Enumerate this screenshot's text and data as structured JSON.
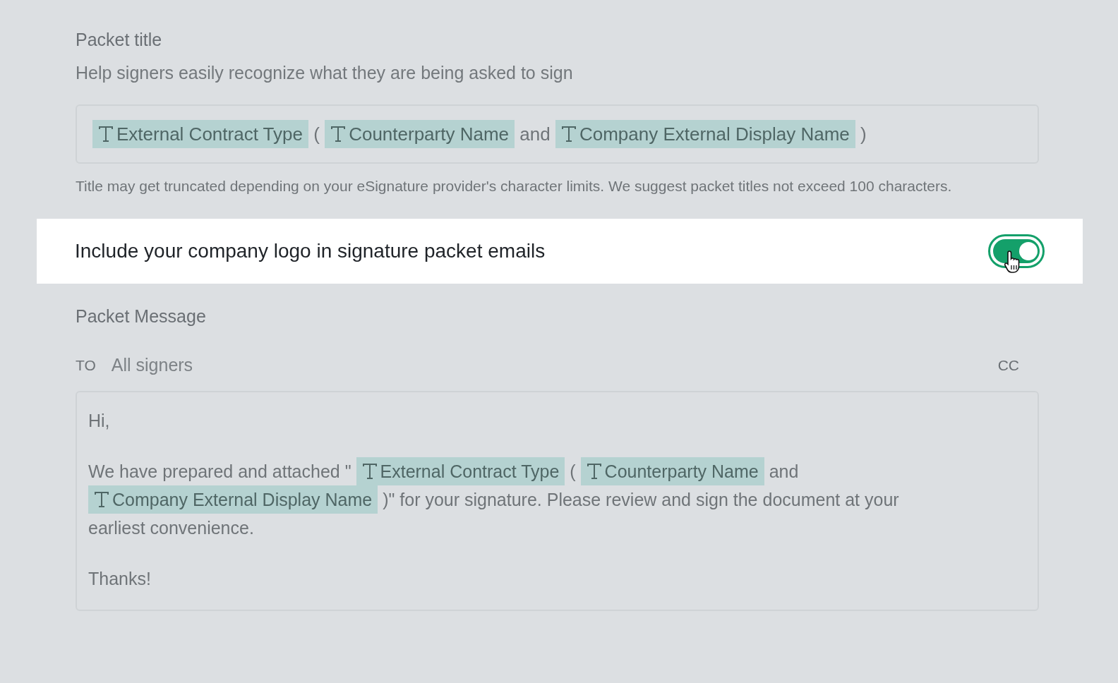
{
  "packet_title": {
    "label": "Packet title",
    "description": "Help signers easily recognize what they are being asked to sign",
    "tokens": [
      {
        "kind": "variable",
        "text": "External Contract Type"
      },
      {
        "kind": "text",
        "text": "("
      },
      {
        "kind": "variable",
        "text": "Counterparty Name"
      },
      {
        "kind": "text",
        "text": "and"
      },
      {
        "kind": "variable",
        "text": "Company External Display Name"
      },
      {
        "kind": "text",
        "text": ")"
      }
    ],
    "hint": "Title may get truncated depending on your eSignature provider's character limits. We suggest packet titles not exceed 100 characters."
  },
  "logo_toggle": {
    "label": "Include your company logo in signature packet emails",
    "on": true
  },
  "packet_message": {
    "label": "Packet Message",
    "to_label": "TO",
    "to_placeholder": "All signers",
    "cc_label": "CC",
    "paragraphs": [
      [
        {
          "kind": "text",
          "text": "Hi,"
        }
      ],
      [
        {
          "kind": "text",
          "text": "We have prepared and attached \""
        },
        {
          "kind": "variable",
          "text": "External Contract Type"
        },
        {
          "kind": "text",
          "text": "("
        },
        {
          "kind": "variable",
          "text": "Counterparty Name"
        },
        {
          "kind": "text",
          "text": "and"
        },
        {
          "kind": "variable",
          "text": "Company External Display Name"
        },
        {
          "kind": "text",
          "text": ")\" for your signature. Please review and sign the document at your"
        },
        {
          "kind": "text",
          "text": "earliest convenience."
        }
      ],
      [
        {
          "kind": "text",
          "text": "Thanks!"
        }
      ]
    ]
  }
}
